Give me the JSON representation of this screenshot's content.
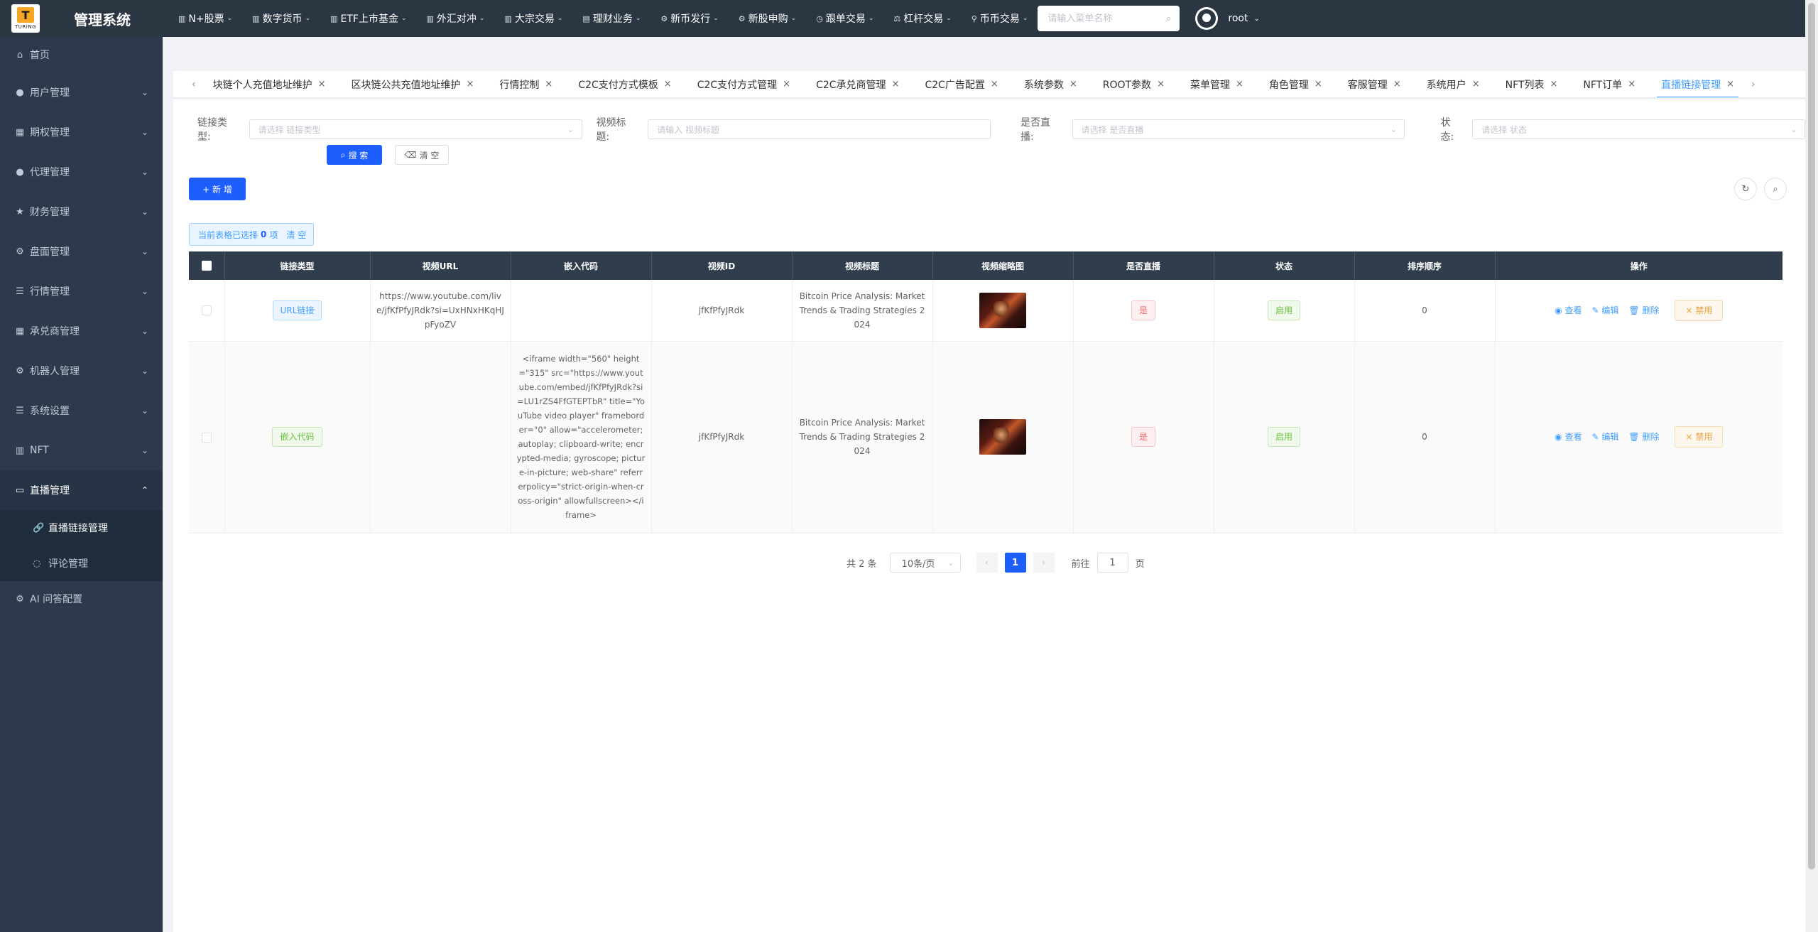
{
  "app": {
    "logo_letter": "T",
    "logo_caption": "TURING",
    "title": "管理系统"
  },
  "topnav": [
    {
      "label": "N+股票",
      "icon": "chart-icon"
    },
    {
      "label": "数字货币",
      "icon": "chart-icon"
    },
    {
      "label": "ETF上市基金",
      "icon": "chart-icon"
    },
    {
      "label": "外汇对冲",
      "icon": "chart-icon"
    },
    {
      "label": "大宗交易",
      "icon": "chart-icon"
    },
    {
      "label": "理财业务",
      "icon": "list-icon"
    },
    {
      "label": "新币发行",
      "icon": "gear-icon"
    },
    {
      "label": "新股申购",
      "icon": "gear-icon"
    },
    {
      "label": "跟单交易",
      "icon": "clock-icon"
    },
    {
      "label": "杠杆交易",
      "icon": "lever-icon"
    },
    {
      "label": "币币交易",
      "icon": "pin-icon"
    }
  ],
  "top_search": {
    "placeholder": "请输入菜单名称"
  },
  "user": {
    "name": "root"
  },
  "sidebar": {
    "items": [
      {
        "label": "首页",
        "icon": "home-icon",
        "has_children": false
      },
      {
        "label": "用户管理",
        "icon": "user-icon",
        "has_children": true
      },
      {
        "label": "期权管理",
        "icon": "table-icon",
        "has_children": true
      },
      {
        "label": "代理管理",
        "icon": "user-icon",
        "has_children": true
      },
      {
        "label": "财务管理",
        "icon": "star-icon",
        "has_children": true
      },
      {
        "label": "盘面管理",
        "icon": "gear-icon",
        "has_children": true
      },
      {
        "label": "行情管理",
        "icon": "list-icon",
        "has_children": true
      },
      {
        "label": "承兑商管理",
        "icon": "table-icon",
        "has_children": true
      },
      {
        "label": "机器人管理",
        "icon": "gear-icon",
        "has_children": true
      },
      {
        "label": "系统设置",
        "icon": "list-icon",
        "has_children": true
      },
      {
        "label": "NFT",
        "icon": "chart-icon",
        "has_children": true
      },
      {
        "label": "直播管理",
        "icon": "video-icon",
        "has_children": true,
        "expanded": true
      }
    ],
    "subitems": [
      {
        "label": "直播链接管理",
        "icon": "link-icon",
        "active": true
      },
      {
        "label": "评论管理",
        "icon": "comment-icon",
        "active": false
      }
    ],
    "last_item": {
      "label": "AI 问答配置",
      "icon": "gear-icon"
    }
  },
  "tags": [
    "块链个人充值地址维护",
    "区块链公共充值地址维护",
    "行情控制",
    "C2C支付方式模板",
    "C2C支付方式管理",
    "C2C承兑商管理",
    "C2C广告配置",
    "系统参数",
    "ROOT参数",
    "菜单管理",
    "角色管理",
    "客服管理",
    "系统用户",
    "NFT列表",
    "NFT订单",
    "直播链接管理"
  ],
  "filters": {
    "link_type": {
      "label": "链接类型:",
      "placeholder": "请选择 链接类型"
    },
    "video_title": {
      "label": "视频标题:",
      "placeholder": "请输入 视频标题"
    },
    "is_live": {
      "label": "是否直播:",
      "placeholder": "请选择 是否直播"
    },
    "status": {
      "label": "状态:",
      "placeholder": "请选择 状态"
    },
    "search_btn": "搜 索",
    "clear_btn": "清 空"
  },
  "add_btn": "+ 新 增",
  "selection": {
    "prefix": "当前表格已选择",
    "count": "0",
    "suffix": "项",
    "clear": "清 空"
  },
  "table": {
    "columns": [
      "链接类型",
      "视频URL",
      "嵌入代码",
      "视频ID",
      "视频标题",
      "视频缩略图",
      "是否直播",
      "状态",
      "排序顺序",
      "操作"
    ],
    "rows": [
      {
        "link_type": "URL链接",
        "url": "https://www.youtube.com/live/jfKfPfyJRdk?si=UxHNxHKqHJpFyoZV",
        "embed": "",
        "video_id": "jfKfPfyJRdk",
        "title": "Bitcoin Price Analysis: Market Trends & Trading Strategies 2024",
        "is_live": "是",
        "status": "启用",
        "order": "0"
      },
      {
        "link_type": "嵌入代码",
        "url": "",
        "embed": "<iframe width=\"560\" height=\"315\" src=\"https://www.youtube.com/embed/jfKfPfyJRdk?si=LU1rZS4FfGTEPTbR\" title=\"YouTube video player\" frameborder=\"0\" allow=\"accelerometer; autoplay; clipboard-write; encrypted-media; gyroscope; picture-in-picture; web-share\" referrerpolicy=\"strict-origin-when-cross-origin\" allowfullscreen></iframe>",
        "video_id": "jfKfPfyJRdk",
        "title": "Bitcoin Price Analysis: Market Trends & Trading Strategies 2024",
        "is_live": "是",
        "status": "启用",
        "order": "0"
      }
    ],
    "actions": {
      "view": "查看",
      "edit": "编辑",
      "delete": "删除",
      "disable": "禁用"
    }
  },
  "pagination": {
    "total": "共 2 条",
    "page_size": "10条/页",
    "current": "1",
    "goto_prefix": "前往",
    "goto_value": "1",
    "goto_suffix": "页"
  }
}
